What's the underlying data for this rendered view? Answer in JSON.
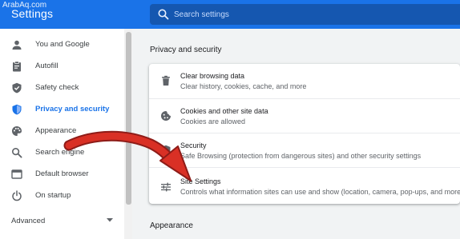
{
  "header": {
    "title": "Settings",
    "search_placeholder": "Search settings",
    "watermark": "ArabAq.com"
  },
  "sidebar": {
    "items": [
      {
        "label": "You and Google",
        "icon": "person-icon"
      },
      {
        "label": "Autofill",
        "icon": "clipboard-icon"
      },
      {
        "label": "Safety check",
        "icon": "shield-check-icon"
      },
      {
        "label": "Privacy and security",
        "icon": "shield-icon",
        "active": true
      },
      {
        "label": "Appearance",
        "icon": "palette-icon"
      },
      {
        "label": "Search engine",
        "icon": "search-icon"
      },
      {
        "label": "Default browser",
        "icon": "browser-window-icon"
      },
      {
        "label": "On startup",
        "icon": "power-icon"
      }
    ],
    "advanced_label": "Advanced"
  },
  "main": {
    "section_title": "Privacy and security",
    "rows": [
      {
        "title": "Clear browsing data",
        "subtitle": "Clear history, cookies, cache, and more",
        "icon": "trash-icon"
      },
      {
        "title": "Cookies and other site data",
        "subtitle": "Cookies are allowed",
        "icon": "cookie-icon"
      },
      {
        "title": "Security",
        "subtitle": "Safe Browsing (protection from dangerous sites) and other security settings",
        "icon": "shield-icon"
      },
      {
        "title": "Site Settings",
        "subtitle": "Controls what information sites can use and show (location, camera, pop-ups, and more)",
        "icon": "sliders-icon"
      }
    ],
    "next_section_title": "Appearance"
  },
  "colors": {
    "accent": "#1a73e8",
    "header_bg": "#1a73e8",
    "search_bg": "#1557b0",
    "annotation_arrow": "#c5221f"
  }
}
